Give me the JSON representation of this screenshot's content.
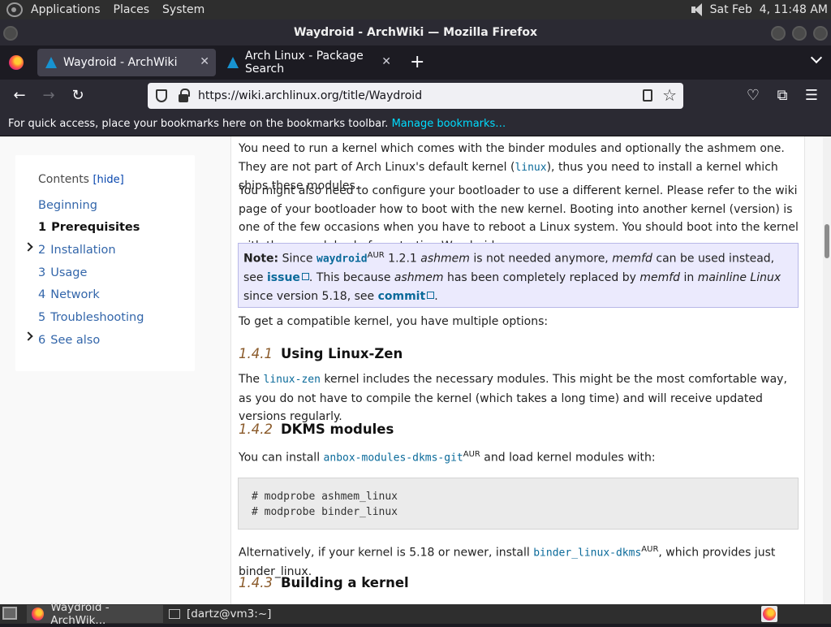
{
  "panel": {
    "menus": [
      "Applications",
      "Places",
      "System"
    ],
    "clock": "Sat Feb  4, 11:48 AM"
  },
  "window": {
    "title": "Waydroid - ArchWiki — Mozilla Firefox"
  },
  "tabs": [
    {
      "label": "Waydroid - ArchWiki",
      "active": true
    },
    {
      "label": "Arch Linux - Package Search",
      "active": false
    }
  ],
  "newtab": "+",
  "urlbar": {
    "url": "https://wiki.archlinux.org/title/Waydroid"
  },
  "bookmarks": {
    "text": "For quick access, place your bookmarks here on the bookmarks toolbar.",
    "link": "Manage bookmarks…"
  },
  "toc": {
    "title": "Contents",
    "hide": "[hide]",
    "items": [
      {
        "num": "",
        "label": "Beginning"
      },
      {
        "num": "1",
        "label": "Prerequisites"
      },
      {
        "num": "2",
        "label": "Installation"
      },
      {
        "num": "3",
        "label": "Usage"
      },
      {
        "num": "4",
        "label": "Network"
      },
      {
        "num": "5",
        "label": "Troubleshooting"
      },
      {
        "num": "6",
        "label": "See also"
      }
    ]
  },
  "article": {
    "p1": {
      "a": "You need to run a kernel which comes with the binder modules and optionally the ashmem one. They are not part of Arch Linux's default kernel (",
      "code": "linux",
      "b": "), thus you need to install a kernel which ships these modules."
    },
    "p2": "You might also need to configure your bootloader to use a different kernel. Please refer to the wiki page of your bootloader how to boot with the new kernel. Booting into another kernel (version) is one of the few occasions when you have to reboot a Linux system. You should boot into the kernel with these modules before starting Waydroid.",
    "note": {
      "label": "Note:",
      "t1": " Since ",
      "pkg": "waydroid",
      "aur": "AUR",
      "t2": " 1.2.1 ",
      "ashmem": "ashmem",
      "t3": " is not needed anymore, ",
      "memfd": "memfd",
      "t4": " can be used instead, see ",
      "issue": "issue",
      "t5": ". This because ",
      "ashmem2": "ashmem",
      "t6": " has been completely replaced by ",
      "memfd2": "memfd",
      "t7": " in ",
      "mainline": "mainline Linux",
      "t8": " since version 5.18, see ",
      "commit": "commit",
      "t9": "."
    },
    "p3": "To get a compatible kernel, you have multiple options:",
    "h141": {
      "sec": "1.4.1",
      "title": "Using Linux-Zen"
    },
    "p4": {
      "a": "The ",
      "code": "linux-zen",
      "b": " kernel includes the necessary modules. This might be the most comfortable way, as you do not have to compile the kernel (which takes a long time) and will receive updated versions regularly."
    },
    "h142": {
      "sec": "1.4.2",
      "title": "DKMS modules"
    },
    "p5": {
      "a": "You can install ",
      "code": "anbox-modules-dkms-git",
      "aur": "AUR",
      "b": " and load kernel modules with:"
    },
    "code": "# modprobe ashmem_linux\n# modprobe binder_linux",
    "p6": {
      "a": "Alternatively, if your kernel is 5.18 or newer, install ",
      "code": "binder_linux-dkms",
      "aur": "AUR",
      "b": ", which provides just binder_linux."
    },
    "h143": {
      "sec": "1.4.3",
      "title": "Building a kernel"
    }
  },
  "taskbar": [
    {
      "label": "Waydroid - ArchWik..."
    },
    {
      "label": "[dartz@vm3:~]"
    }
  ]
}
